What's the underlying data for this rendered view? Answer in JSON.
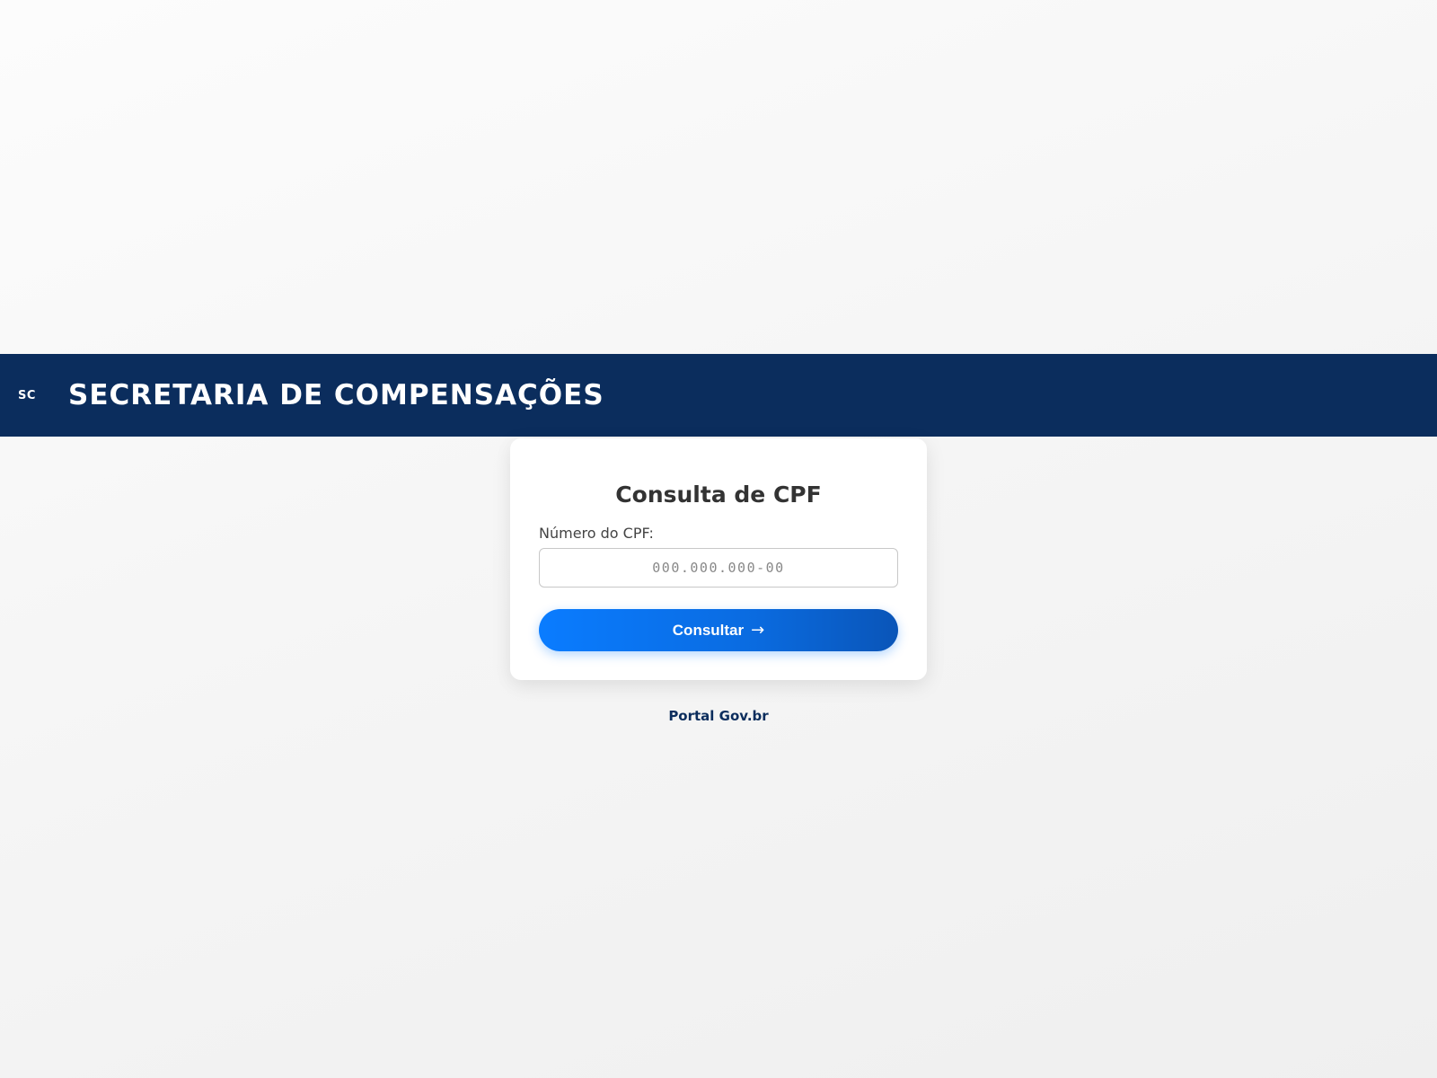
{
  "header": {
    "logo_text": "SC",
    "title": "SECRETARIA DE COMPENSAÇÕES"
  },
  "card": {
    "title": "Consulta de CPF",
    "cpf_label": "Número do CPF:",
    "cpf_value": "",
    "cpf_placeholder": "000.000.000-00",
    "submit_label": "Consultar",
    "submit_icon": "→"
  },
  "footer": {
    "link_text": "Portal Gov.br"
  },
  "colors": {
    "header_bg": "#0b2d5d",
    "button_start": "#0a7cff",
    "button_end": "#0a55b8",
    "link": "#0b2d5d"
  }
}
